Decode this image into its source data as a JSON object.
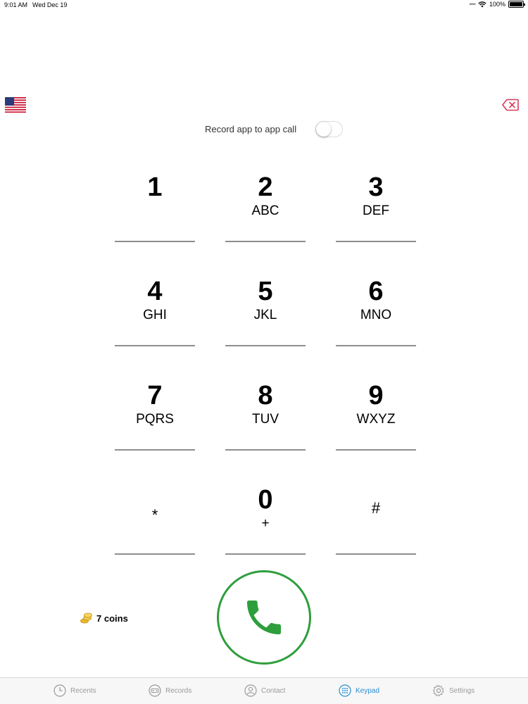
{
  "status_bar": {
    "time": "9:01 AM",
    "date": "Wed Dec 19",
    "battery": "100%"
  },
  "country_flag": "us-flag-icon",
  "record": {
    "label": "Record app to app call",
    "enabled": false
  },
  "keypad": [
    {
      "digit": "1",
      "letters": ""
    },
    {
      "digit": "2",
      "letters": "ABC"
    },
    {
      "digit": "3",
      "letters": "DEF"
    },
    {
      "digit": "4",
      "letters": "GHI"
    },
    {
      "digit": "5",
      "letters": "JKL"
    },
    {
      "digit": "6",
      "letters": "MNO"
    },
    {
      "digit": "7",
      "letters": "PQRS"
    },
    {
      "digit": "8",
      "letters": "TUV"
    },
    {
      "digit": "9",
      "letters": "WXYZ"
    },
    {
      "digit": "*",
      "letters": ""
    },
    {
      "digit": "0",
      "letters": "+"
    },
    {
      "digit": "#",
      "letters": ""
    }
  ],
  "coins": {
    "label": "7 coins"
  },
  "tabs": [
    {
      "label": "Recents",
      "icon": "clock-icon",
      "active": false
    },
    {
      "label": "Records",
      "icon": "record-icon",
      "active": false
    },
    {
      "label": "Contact",
      "icon": "contact-icon",
      "active": false
    },
    {
      "label": "Keypad",
      "icon": "keypad-icon",
      "active": true
    },
    {
      "label": "Settings",
      "icon": "gear-icon",
      "active": false
    }
  ],
  "colors": {
    "call_green": "#2e9e3d",
    "active_tab": "#2a8fd6",
    "backspace_red": "#d63b5a"
  }
}
